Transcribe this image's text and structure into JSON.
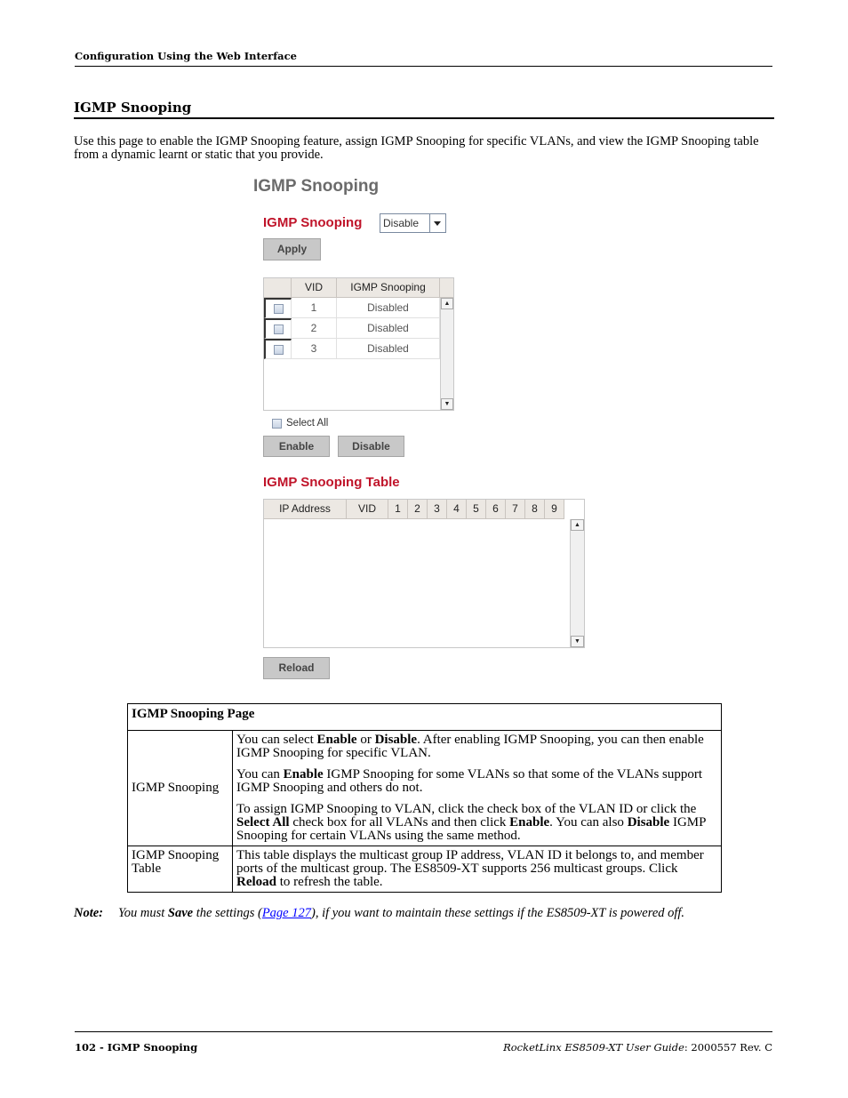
{
  "header": {
    "running_title": "Configuration Using the Web Interface"
  },
  "section": {
    "title": "IGMP Snooping",
    "intro": "Use this page to enable the IGMP Snooping feature, assign IGMP Snooping for specific VLANs, and view the IGMP Snooping table from a dynamic learnt or static that you provide."
  },
  "ui": {
    "page_title": "IGMP Snooping",
    "igmp_label": "IGMP Snooping",
    "igmp_select_value": "Disable",
    "apply_label": "Apply",
    "vlan_table": {
      "headers": [
        "VID",
        "IGMP Snooping"
      ],
      "rows": [
        {
          "vid": "1",
          "status": "Disabled"
        },
        {
          "vid": "2",
          "status": "Disabled"
        },
        {
          "vid": "3",
          "status": "Disabled"
        }
      ]
    },
    "select_all_label": "Select All",
    "enable_label": "Enable",
    "disable_label": "Disable",
    "table_title": "IGMP Snooping Table",
    "snoop_table_headers": [
      "IP Address",
      "VID",
      "1",
      "2",
      "3",
      "4",
      "5",
      "6",
      "7",
      "8",
      "9"
    ],
    "reload_label": "Reload",
    "accent_color": "#c0142a"
  },
  "doc_table": {
    "title": "IGMP Snooping Page",
    "rows": [
      {
        "label": "IGMP Snooping",
        "paragraphs": [
          [
            {
              "t": "You can select "
            },
            {
              "t": "Enable",
              "b": true
            },
            {
              "t": " or "
            },
            {
              "t": "Disable",
              "b": true
            },
            {
              "t": ". After enabling IGMP Snooping, you can then enable IGMP Snooping for specific VLAN."
            }
          ],
          [
            {
              "t": "You can "
            },
            {
              "t": "Enable",
              "b": true
            },
            {
              "t": " IGMP Snooping for some VLANs so that some of the VLANs support IGMP Snooping and others do not."
            }
          ],
          [
            {
              "t": "To assign IGMP Snooping to VLAN, click the check box of the VLAN ID or click the "
            },
            {
              "t": "Select All",
              "b": true
            },
            {
              "t": " check box for all VLANs and then click "
            },
            {
              "t": "Enable",
              "b": true
            },
            {
              "t": ". You can also "
            },
            {
              "t": "Disable",
              "b": true
            },
            {
              "t": " IGMP Snooping for certain VLANs using the same method."
            }
          ]
        ]
      },
      {
        "label": "IGMP Snooping Table",
        "paragraphs": [
          [
            {
              "t": "This table displays the multicast group IP address, VLAN ID it belongs to, and member ports of the multicast group. The ES8509-XT supports 256 multicast groups. Click "
            },
            {
              "t": "Reload",
              "b": true
            },
            {
              "t": " to refresh the table."
            }
          ]
        ]
      }
    ]
  },
  "note": {
    "label": "Note:",
    "pre": "You must ",
    "save": "Save",
    "mid": " the settings (",
    "link": "Page 127",
    "post": "), if you want to maintain these settings if the ES8509-XT is powered off."
  },
  "footer": {
    "left": "102 - IGMP Snooping",
    "right_italic": "RocketLinx ES8509-XT User Guide",
    "right_rest": ": 2000557 Rev. C"
  }
}
